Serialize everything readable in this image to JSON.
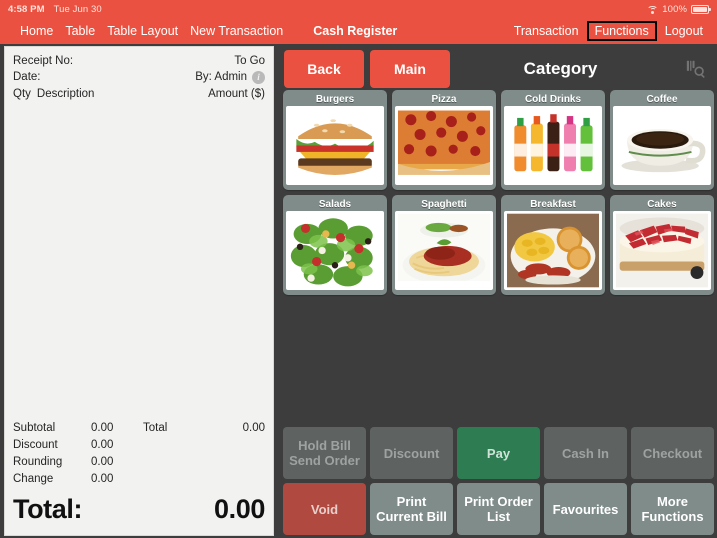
{
  "statusbar": {
    "time": "4:58 PM",
    "date": "Tue Jun 30",
    "battery_percent": "100%",
    "wifi_icon": "wifi-icon",
    "battery_icon": "battery-icon"
  },
  "navbar": {
    "left_items": [
      {
        "label": "Home",
        "name": "nav-home"
      },
      {
        "label": "Table",
        "name": "nav-table"
      },
      {
        "label": "Table Layout",
        "name": "nav-table-layout"
      },
      {
        "label": "New Transaction",
        "name": "nav-new-transaction"
      }
    ],
    "page_title": "Cash Register",
    "right_items": [
      {
        "label": "Transaction",
        "name": "nav-transaction",
        "highlighted": false
      },
      {
        "label": "Functions",
        "name": "nav-functions",
        "highlighted": true
      },
      {
        "label": "Logout",
        "name": "nav-logout",
        "highlighted": false
      }
    ]
  },
  "receipt": {
    "receipt_no_label": "Receipt No:",
    "receipt_no_value": "To Go",
    "date_label": "Date:",
    "date_value": "By: Admin",
    "info_icon": "info-icon",
    "col_qty": "Qty",
    "col_description": "Description",
    "col_amount": "Amount ($)",
    "items": [],
    "totals": [
      {
        "label": "Subtotal",
        "value": "0.00"
      },
      {
        "label": "Discount",
        "value": "0.00"
      },
      {
        "label": "Rounding",
        "value": "0.00"
      },
      {
        "label": "Change",
        "value": "0.00"
      }
    ],
    "total_side_label": "Total",
    "total_side_value": "0.00",
    "grand_total_label": "Total:",
    "grand_total_value": "0.00"
  },
  "category_panel": {
    "back_label": "Back",
    "main_label": "Main",
    "title": "Category",
    "search_icon": "search-icon",
    "tiles": [
      {
        "label": "Burgers",
        "image": "burger-photo"
      },
      {
        "label": "Pizza",
        "image": "pizza-photo"
      },
      {
        "label": "Cold Drinks",
        "image": "soda-bottles-photo"
      },
      {
        "label": "Coffee",
        "image": "coffee-cup-photo"
      },
      {
        "label": "Salads",
        "image": "salad-photo"
      },
      {
        "label": "Spaghetti",
        "image": "spaghetti-photo"
      },
      {
        "label": "Breakfast",
        "image": "breakfast-photo"
      },
      {
        "label": "Cakes",
        "image": "strawberry-cake-photo"
      }
    ]
  },
  "actions": [
    {
      "label": "Hold Bill\nSend Order",
      "name": "hold-bill-send-order-button",
      "style": "disabled"
    },
    {
      "label": "Discount",
      "name": "discount-button",
      "style": "disabled"
    },
    {
      "label": "Pay",
      "name": "pay-button",
      "style": "pay"
    },
    {
      "label": "Cash In",
      "name": "cash-in-button",
      "style": "disabled"
    },
    {
      "label": "Checkout",
      "name": "checkout-button",
      "style": "disabled"
    },
    {
      "label": "Void",
      "name": "void-button",
      "style": "void"
    },
    {
      "label": "Print\nCurrent Bill",
      "name": "print-current-bill-button",
      "style": "normal"
    },
    {
      "label": "Print Order\nList",
      "name": "print-order-list-button",
      "style": "normal"
    },
    {
      "label": "Favourites",
      "name": "favourites-button",
      "style": "normal"
    },
    {
      "label": "More\nFunctions",
      "name": "more-functions-button",
      "style": "normal"
    }
  ],
  "colors": {
    "brand_red": "#eb5140",
    "panel_dark": "#3d3d3d",
    "tile_grey": "#7f8c8a",
    "pay_green": "#2e7d52",
    "void_red": "#b0493f",
    "disabled_grey": "#5e6361",
    "receipt_bg": "#f2f2f0",
    "highlight_box": "#000000"
  }
}
